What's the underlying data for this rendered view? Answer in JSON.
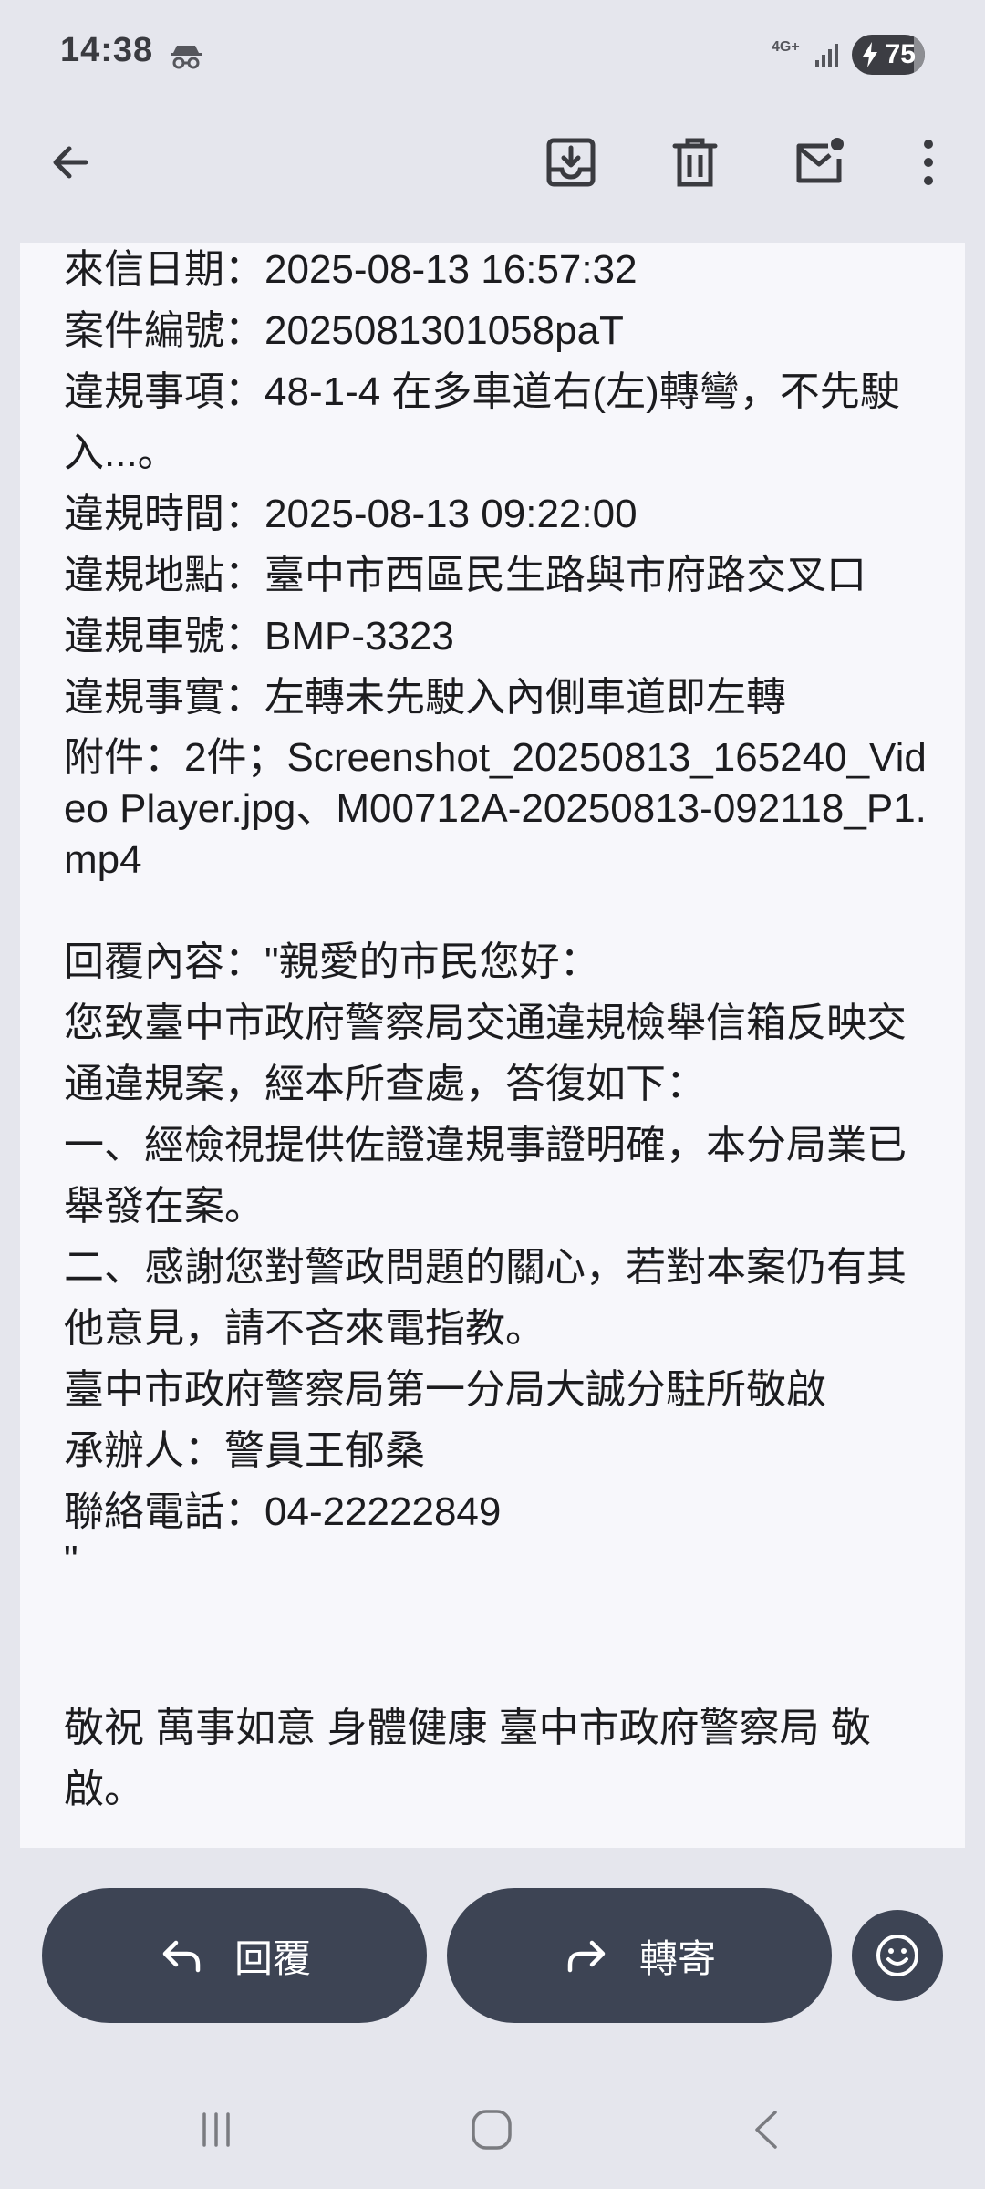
{
  "status_bar": {
    "time": "14:38",
    "network": "4G+",
    "battery_level": "75",
    "icons": [
      "incognito-icon",
      "signal-icon",
      "battery-charging-icon"
    ]
  },
  "toolbar": {
    "icons": [
      "back-arrow-icon",
      "archive-icon",
      "trash-icon",
      "mark-unread-icon",
      "more-vert-icon"
    ]
  },
  "email": {
    "lines": [
      "來信日期：2025-08-13 16:57:32",
      "案件編號：2025081301058paT",
      "違規事項：48-1-4 在多車道右(左)轉彎，不先駛入...。",
      "違規時間：2025-08-13 09:22:00",
      "違規地點：臺中市西區民生路與市府路交叉口",
      "違規車號：BMP-3323",
      "違規事實：左轉未先駛入內側車道即左轉",
      "附件：2件；Screenshot_20250813_165240_Video Player.jpg、M00712A-20250813-092118_P1.mp4"
    ],
    "reply_lines": [
      "回覆內容：\"親愛的市民您好：",
      "您致臺中市政府警察局交通違規檢舉信箱反映交通違規案，經本所查處，答復如下：",
      "一、經檢視提供佐證違規事證明確，本分局業已舉發在案。",
      "二、感謝您對警政問題的關心，若對本案仍有其他意見，請不吝來電指教。",
      "臺中市政府警察局第一分局大誠分駐所敬啟",
      "承辦人：警員王郁桑",
      "聯絡電話：04-22222849",
      "\""
    ],
    "closing": "敬祝 萬事如意 身體健康 臺中市政府警察局 敬啟。"
  },
  "actions": {
    "reply_label": "回覆",
    "forward_label": "轉寄"
  },
  "colors": {
    "background": "#e5e6ed",
    "card": "#f7f7fb",
    "button": "#3d4454",
    "text": "#1c1c1f"
  }
}
